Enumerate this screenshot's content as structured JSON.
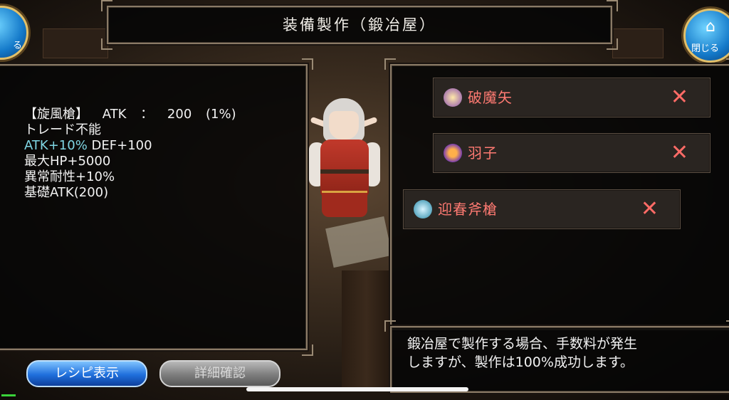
{
  "title": "装備製作（鍛冶屋）",
  "corner_buttons": {
    "left_label": "る",
    "left_icon": "",
    "right_label": "閉じる",
    "right_icon": "⌂"
  },
  "item": {
    "name": "【旋風槍】",
    "atk_label": "ATK",
    "atk_sep": "：",
    "atk_value": "200",
    "atk_pct": "(1%)",
    "trade": "トレード不能",
    "bonus_atk": "ATK+10%",
    "bonus_def": "DEF+100",
    "hp": "最大HP+5000",
    "resist": "異常耐性+10%",
    "base_atk": "基礎ATK(200)"
  },
  "materials": [
    {
      "label": "破魔矢",
      "icon": "arrow-icon",
      "remove": "✕"
    },
    {
      "label": "羽子",
      "icon": "shuttlecock-icon",
      "remove": "✕"
    },
    {
      "label": "迎春斧槍",
      "icon": "halberd-icon",
      "remove": "✕"
    }
  ],
  "message": {
    "line1": "鍛冶屋で製作する場合、手数料が発生",
    "line2": "しますが、製作は100%成功します。"
  },
  "buttons": {
    "recipe": "レシピ表示",
    "detail": "詳細確認"
  },
  "colors": {
    "material_text": "#ff7a72",
    "bonus_text": "#7fd6e4",
    "recipe_button": "#1f6fdc",
    "detail_button": "#7d7d7d"
  }
}
